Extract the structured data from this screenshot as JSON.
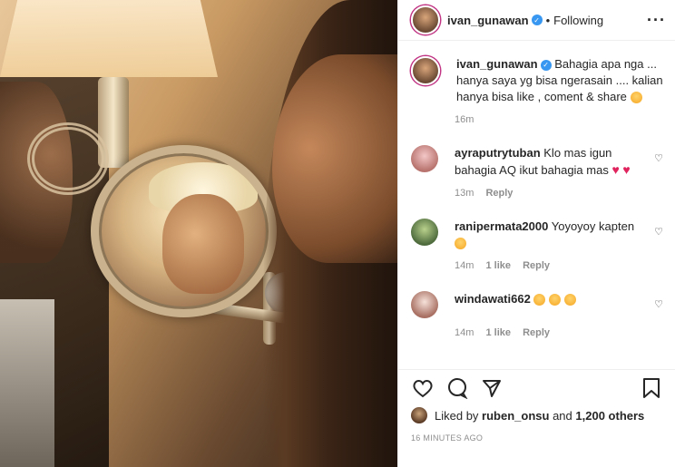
{
  "post": {
    "username": "ivan_gunawan",
    "follow_status": "Following",
    "caption": "Bahagia apa nga ... hanya saya yg bisa ngerasain .... kalian hanya bisa like , coment & share",
    "caption_time": "16m"
  },
  "comments": [
    {
      "username": "ayraputrytuban",
      "text": "Klo mas igun bahagia AQ ikut bahagia mas",
      "time": "13m",
      "likes": "",
      "reply": "Reply"
    },
    {
      "username": "ranipermata2000",
      "text": "Yoyoyoy kapten",
      "time": "14m",
      "likes": "1 like",
      "reply": "Reply"
    },
    {
      "username": "windawati662",
      "text": "",
      "time": "14m",
      "likes": "1 like",
      "reply": "Reply"
    }
  ],
  "likes": {
    "prefix": "Liked by",
    "user": "ruben_onsu",
    "and": "and",
    "count": "1,200 others"
  },
  "timestamp": "16 MINUTES AGO",
  "icons": {
    "more": "more-icon",
    "heart": "heart-icon",
    "comment": "comment-icon",
    "share": "share-icon",
    "save": "bookmark-icon"
  },
  "colors": {
    "accent": "#3897f0",
    "heart": "#e0245e",
    "muted": "#8e8e8e"
  }
}
